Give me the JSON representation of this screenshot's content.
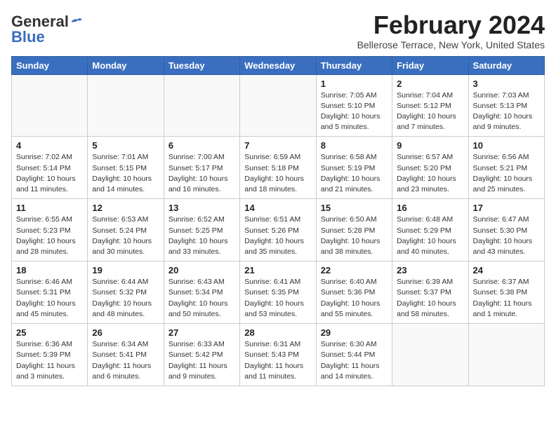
{
  "logo": {
    "general": "General",
    "blue": "Blue"
  },
  "header": {
    "month": "February 2024",
    "location": "Bellerose Terrace, New York, United States"
  },
  "weekdays": [
    "Sunday",
    "Monday",
    "Tuesday",
    "Wednesday",
    "Thursday",
    "Friday",
    "Saturday"
  ],
  "weeks": [
    [
      {
        "day": "",
        "info": ""
      },
      {
        "day": "",
        "info": ""
      },
      {
        "day": "",
        "info": ""
      },
      {
        "day": "",
        "info": ""
      },
      {
        "day": "1",
        "info": "Sunrise: 7:05 AM\nSunset: 5:10 PM\nDaylight: 10 hours\nand 5 minutes."
      },
      {
        "day": "2",
        "info": "Sunrise: 7:04 AM\nSunset: 5:12 PM\nDaylight: 10 hours\nand 7 minutes."
      },
      {
        "day": "3",
        "info": "Sunrise: 7:03 AM\nSunset: 5:13 PM\nDaylight: 10 hours\nand 9 minutes."
      }
    ],
    [
      {
        "day": "4",
        "info": "Sunrise: 7:02 AM\nSunset: 5:14 PM\nDaylight: 10 hours\nand 11 minutes."
      },
      {
        "day": "5",
        "info": "Sunrise: 7:01 AM\nSunset: 5:15 PM\nDaylight: 10 hours\nand 14 minutes."
      },
      {
        "day": "6",
        "info": "Sunrise: 7:00 AM\nSunset: 5:17 PM\nDaylight: 10 hours\nand 16 minutes."
      },
      {
        "day": "7",
        "info": "Sunrise: 6:59 AM\nSunset: 5:18 PM\nDaylight: 10 hours\nand 18 minutes."
      },
      {
        "day": "8",
        "info": "Sunrise: 6:58 AM\nSunset: 5:19 PM\nDaylight: 10 hours\nand 21 minutes."
      },
      {
        "day": "9",
        "info": "Sunrise: 6:57 AM\nSunset: 5:20 PM\nDaylight: 10 hours\nand 23 minutes."
      },
      {
        "day": "10",
        "info": "Sunrise: 6:56 AM\nSunset: 5:21 PM\nDaylight: 10 hours\nand 25 minutes."
      }
    ],
    [
      {
        "day": "11",
        "info": "Sunrise: 6:55 AM\nSunset: 5:23 PM\nDaylight: 10 hours\nand 28 minutes."
      },
      {
        "day": "12",
        "info": "Sunrise: 6:53 AM\nSunset: 5:24 PM\nDaylight: 10 hours\nand 30 minutes."
      },
      {
        "day": "13",
        "info": "Sunrise: 6:52 AM\nSunset: 5:25 PM\nDaylight: 10 hours\nand 33 minutes."
      },
      {
        "day": "14",
        "info": "Sunrise: 6:51 AM\nSunset: 5:26 PM\nDaylight: 10 hours\nand 35 minutes."
      },
      {
        "day": "15",
        "info": "Sunrise: 6:50 AM\nSunset: 5:28 PM\nDaylight: 10 hours\nand 38 minutes."
      },
      {
        "day": "16",
        "info": "Sunrise: 6:48 AM\nSunset: 5:29 PM\nDaylight: 10 hours\nand 40 minutes."
      },
      {
        "day": "17",
        "info": "Sunrise: 6:47 AM\nSunset: 5:30 PM\nDaylight: 10 hours\nand 43 minutes."
      }
    ],
    [
      {
        "day": "18",
        "info": "Sunrise: 6:46 AM\nSunset: 5:31 PM\nDaylight: 10 hours\nand 45 minutes."
      },
      {
        "day": "19",
        "info": "Sunrise: 6:44 AM\nSunset: 5:32 PM\nDaylight: 10 hours\nand 48 minutes."
      },
      {
        "day": "20",
        "info": "Sunrise: 6:43 AM\nSunset: 5:34 PM\nDaylight: 10 hours\nand 50 minutes."
      },
      {
        "day": "21",
        "info": "Sunrise: 6:41 AM\nSunset: 5:35 PM\nDaylight: 10 hours\nand 53 minutes."
      },
      {
        "day": "22",
        "info": "Sunrise: 6:40 AM\nSunset: 5:36 PM\nDaylight: 10 hours\nand 55 minutes."
      },
      {
        "day": "23",
        "info": "Sunrise: 6:39 AM\nSunset: 5:37 PM\nDaylight: 10 hours\nand 58 minutes."
      },
      {
        "day": "24",
        "info": "Sunrise: 6:37 AM\nSunset: 5:38 PM\nDaylight: 11 hours\nand 1 minute."
      }
    ],
    [
      {
        "day": "25",
        "info": "Sunrise: 6:36 AM\nSunset: 5:39 PM\nDaylight: 11 hours\nand 3 minutes."
      },
      {
        "day": "26",
        "info": "Sunrise: 6:34 AM\nSunset: 5:41 PM\nDaylight: 11 hours\nand 6 minutes."
      },
      {
        "day": "27",
        "info": "Sunrise: 6:33 AM\nSunset: 5:42 PM\nDaylight: 11 hours\nand 9 minutes."
      },
      {
        "day": "28",
        "info": "Sunrise: 6:31 AM\nSunset: 5:43 PM\nDaylight: 11 hours\nand 11 minutes."
      },
      {
        "day": "29",
        "info": "Sunrise: 6:30 AM\nSunset: 5:44 PM\nDaylight: 11 hours\nand 14 minutes."
      },
      {
        "day": "",
        "info": ""
      },
      {
        "day": "",
        "info": ""
      }
    ]
  ]
}
